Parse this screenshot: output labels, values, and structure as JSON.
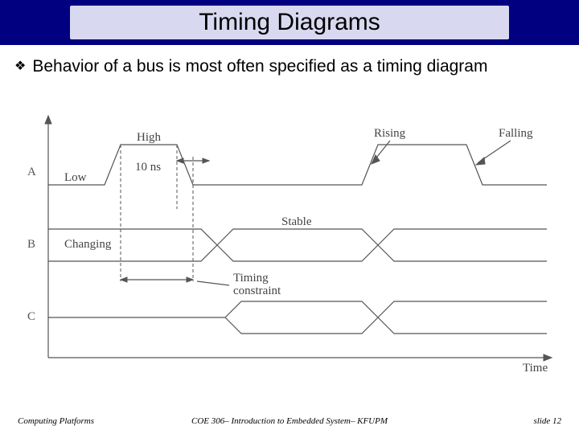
{
  "title": "Timing Diagrams",
  "bullet": "Behavior of a bus is most often specified as a timing diagram",
  "diagram": {
    "signal_a": "A",
    "signal_b": "B",
    "signal_c": "C",
    "low": "Low",
    "high": "High",
    "ten_ns": "10 ns",
    "rising": "Rising",
    "falling": "Falling",
    "changing": "Changing",
    "stable": "Stable",
    "timing_constraint": "Timing\nconstraint",
    "time": "Time"
  },
  "footer": {
    "left": "Computing Platforms",
    "center": "COE 306– Introduction to Embedded System– KFUPM",
    "right": "slide 12"
  }
}
